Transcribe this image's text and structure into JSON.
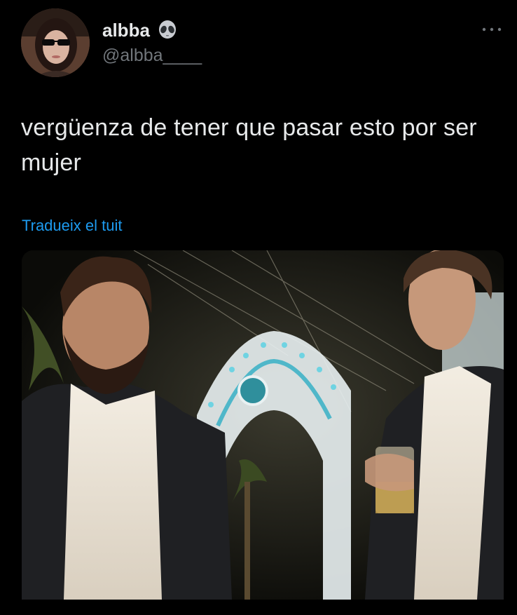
{
  "tweet": {
    "author": {
      "display_name": "albba",
      "name_icon": "alien-emoji-icon",
      "handle": "@albba____",
      "avatar_icon": "avatar-photo"
    },
    "more_icon": "more-horizontal-icon",
    "text": "vergüenza de tener que pasar esto por ser mujer",
    "translate_label": "Tradueix el tuit",
    "media": {
      "icon": "video-photo-media"
    }
  },
  "colors": {
    "background": "#000000",
    "text_primary": "#e7e9ea",
    "text_secondary": "#71767b",
    "link": "#1d9bf0"
  }
}
